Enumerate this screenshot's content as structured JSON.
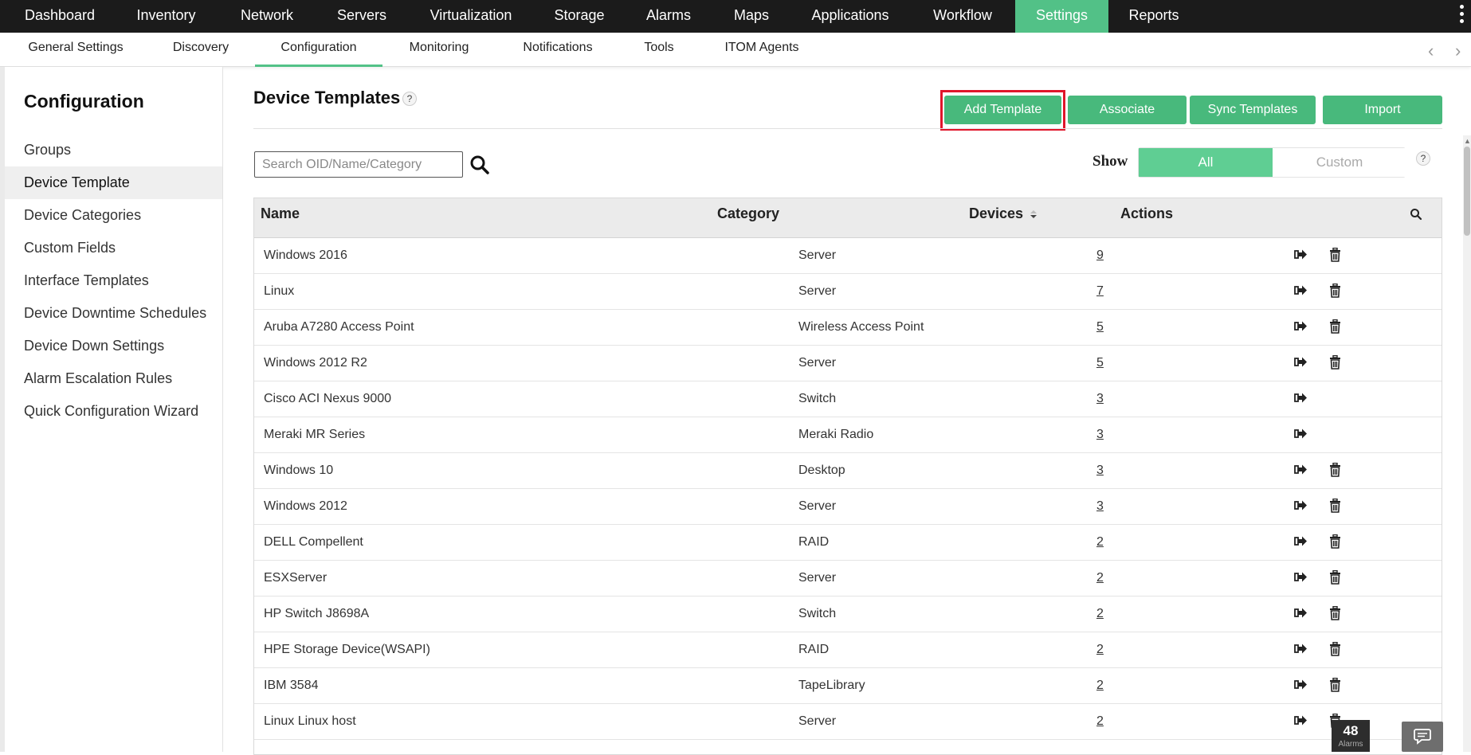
{
  "top_nav": {
    "items": [
      "Dashboard",
      "Inventory",
      "Network",
      "Servers",
      "Virtualization",
      "Storage",
      "Alarms",
      "Maps",
      "Applications",
      "Workflow",
      "Settings",
      "Reports"
    ],
    "active": "Settings"
  },
  "sub_nav": {
    "items": [
      "General Settings",
      "Discovery",
      "Configuration",
      "Monitoring",
      "Notifications",
      "Tools",
      "ITOM Agents"
    ],
    "active": "Configuration",
    "prev_arrow": "‹",
    "next_arrow": "›"
  },
  "sidebar": {
    "title": "Configuration",
    "items": [
      "Groups",
      "Device Template",
      "Device Categories",
      "Custom Fields",
      "Interface Templates",
      "Device Downtime Schedules",
      "Device Down Settings",
      "Alarm Escalation Rules",
      "Quick Configuration Wizard"
    ],
    "active": "Device Template"
  },
  "main": {
    "title": "Device Templates",
    "help": "?",
    "buttons": {
      "add": "Add Template",
      "associate": "Associate",
      "sync": "Sync Templates",
      "import": "Import"
    },
    "search": {
      "placeholder": "Search OID/Name/Category",
      "value": ""
    },
    "show": {
      "label": "Show",
      "options": [
        "All",
        "Custom"
      ],
      "selected": "All",
      "help": "?"
    },
    "table": {
      "columns": [
        "Name",
        "Category",
        "Devices",
        "Actions"
      ],
      "rows": [
        {
          "name": "Windows 2016",
          "category": "Server",
          "devices": "9",
          "deletable": true
        },
        {
          "name": "Linux",
          "category": "Server",
          "devices": "7",
          "deletable": true
        },
        {
          "name": "Aruba A7280 Access Point",
          "category": "Wireless Access Point",
          "devices": "5",
          "deletable": true
        },
        {
          "name": "Windows 2012 R2",
          "category": "Server",
          "devices": "5",
          "deletable": true
        },
        {
          "name": "Cisco ACI Nexus 9000",
          "category": "Switch",
          "devices": "3",
          "deletable": false
        },
        {
          "name": "Meraki MR Series",
          "category": "Meraki Radio",
          "devices": "3",
          "deletable": false
        },
        {
          "name": "Windows 10",
          "category": "Desktop",
          "devices": "3",
          "deletable": true
        },
        {
          "name": "Windows 2012",
          "category": "Server",
          "devices": "3",
          "deletable": true
        },
        {
          "name": "DELL Compellent",
          "category": "RAID",
          "devices": "2",
          "deletable": true
        },
        {
          "name": "ESXServer",
          "category": "Server",
          "devices": "2",
          "deletable": true
        },
        {
          "name": "HP Switch J8698A",
          "category": "Switch",
          "devices": "2",
          "deletable": true
        },
        {
          "name": "HPE Storage Device(WSAPI)",
          "category": "RAID",
          "devices": "2",
          "deletable": true
        },
        {
          "name": "IBM 3584",
          "category": "TapeLibrary",
          "devices": "2",
          "deletable": true
        },
        {
          "name": "Linux Linux host",
          "category": "Server",
          "devices": "2",
          "deletable": true
        }
      ]
    }
  },
  "footer": {
    "alarm_count": "48",
    "alarm_label": "Alarms"
  },
  "colors": {
    "accent": "#52c187",
    "button": "#48b97c",
    "nav_bg": "#1b1b1b",
    "highlight": "#e0162b"
  }
}
